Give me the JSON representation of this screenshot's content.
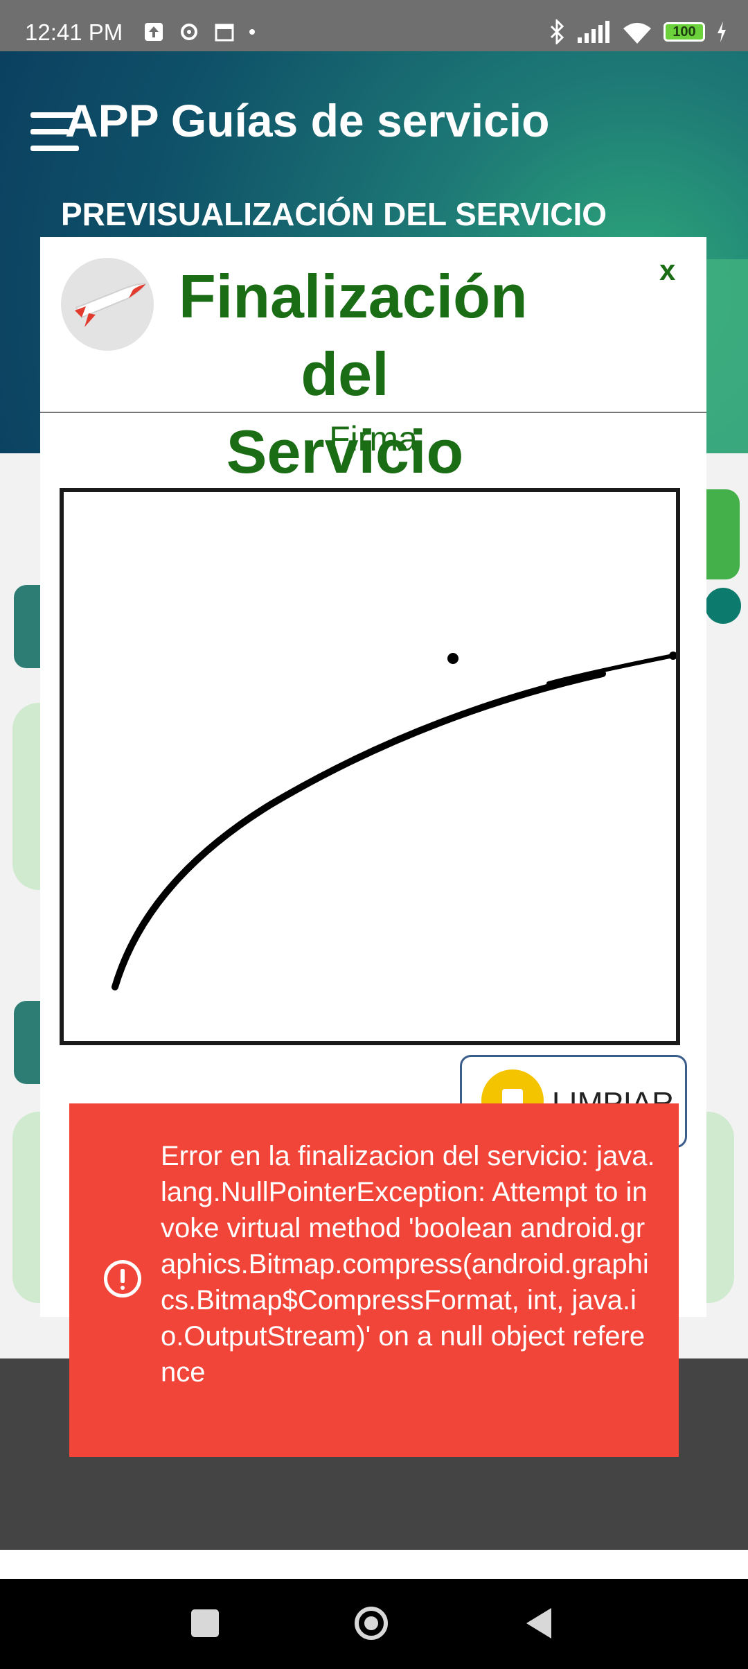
{
  "status_bar": {
    "time": "12:41 PM",
    "battery": "100",
    "icons": [
      "upload-icon",
      "settings-icon",
      "calendar-icon",
      "dot-icon",
      "bluetooth-icon",
      "signal-icon",
      "wifi-icon",
      "battery-icon",
      "charging-icon"
    ]
  },
  "header": {
    "title": "APP Guías de servicio",
    "subtitle": "PREVISUALIZACIÓN DEL SERVICIO"
  },
  "dialog": {
    "title": "Finalización del Servicio",
    "close": "x",
    "firma_label": "Firma",
    "clear_button": "LIMPIAR"
  },
  "error": {
    "message": "Error en la finalizacion del servicio: java.lang.NullPointerException: Attempt to invoke virtual method 'boolean android.graphics.Bitmap.compress(android.graphics.Bitmap$CompressFormat, int, java.io.OutputStream)' on a null object reference"
  },
  "colors": {
    "accent_green": "#1b6d15",
    "error_red": "#f2453a"
  }
}
